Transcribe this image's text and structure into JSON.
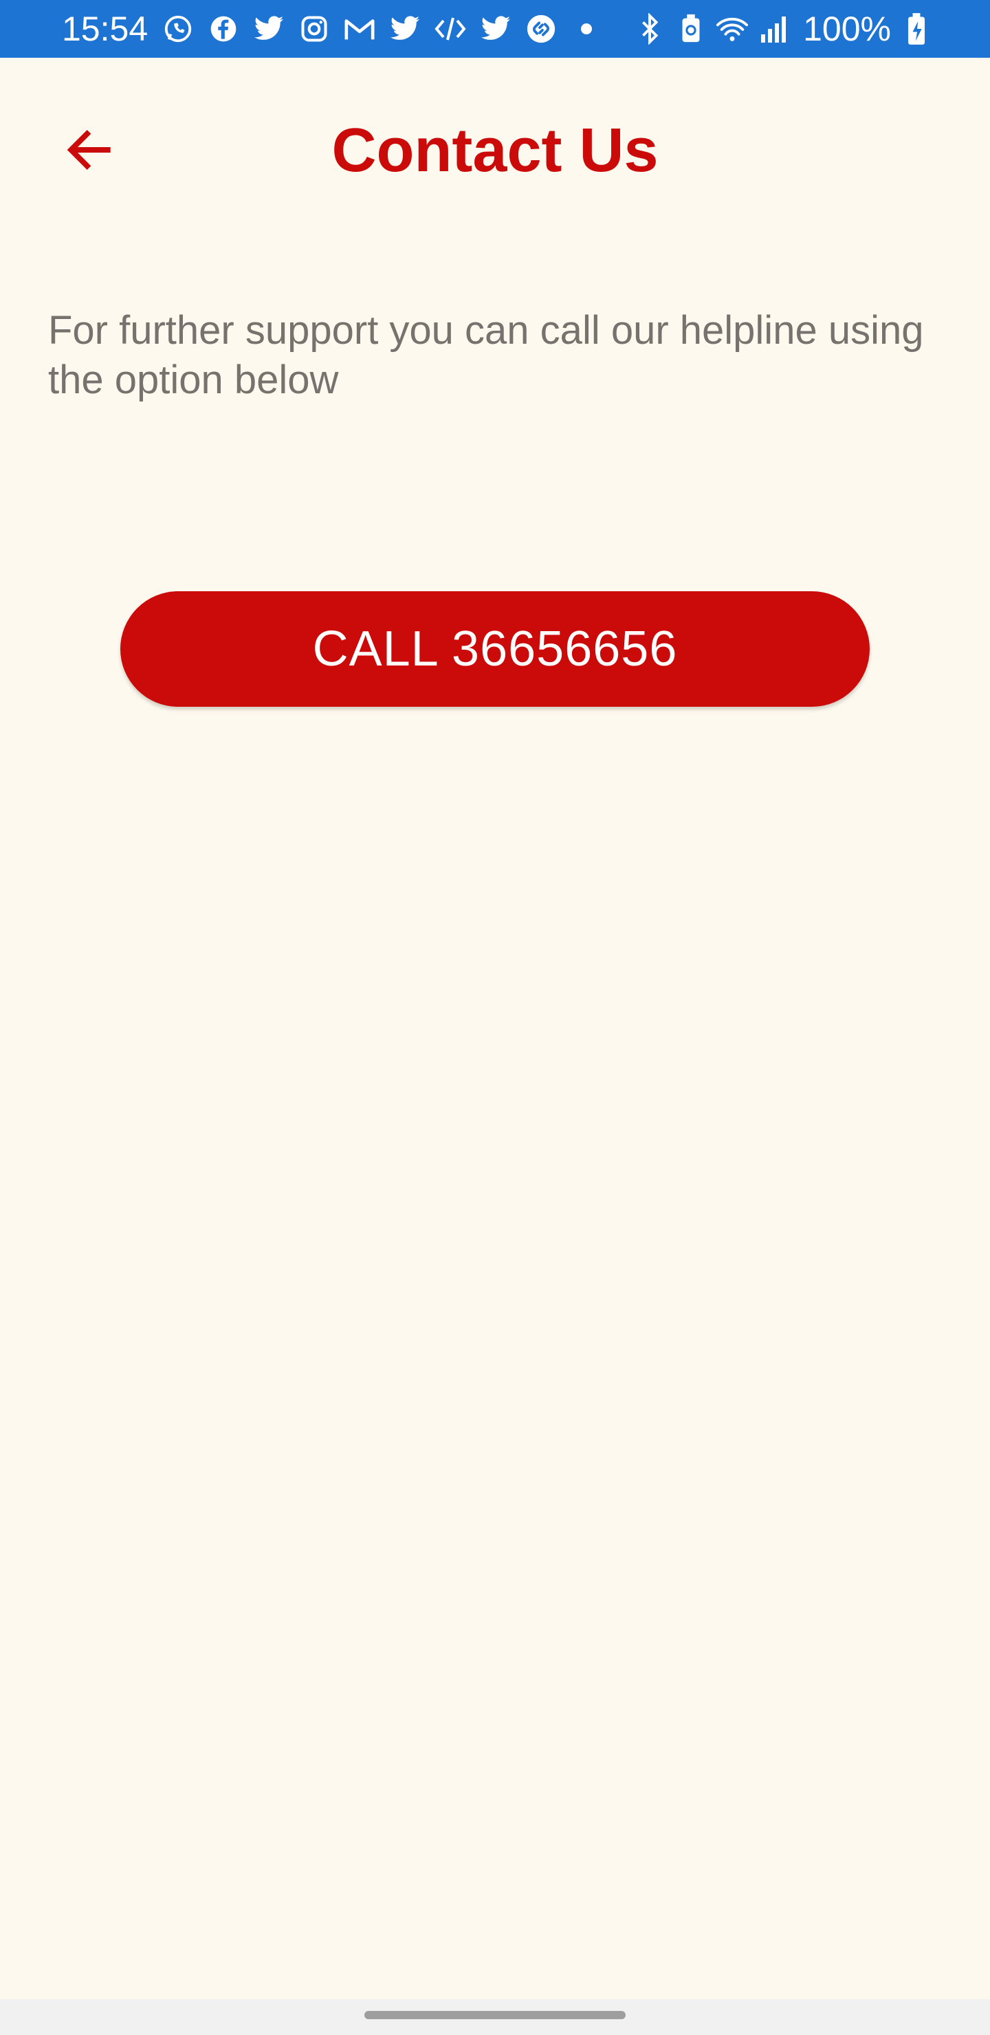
{
  "status_bar": {
    "time": "15:54",
    "notification_icons": [
      "whatsapp-icon",
      "facebook-icon",
      "twitter-icon",
      "instagram-icon",
      "gmail-icon",
      "twitter-icon",
      "code-icon",
      "twitter-icon",
      "shazam-icon",
      "dot-icon"
    ],
    "system_icons": [
      "bluetooth-icon",
      "battery-saver-icon",
      "wifi-icon",
      "signal-icon"
    ],
    "battery": "100%",
    "colors": {
      "background": "#1E74D3",
      "foreground": "#FFFFFF"
    }
  },
  "header": {
    "title": "Contact Us",
    "back_icon": "arrow-left-icon",
    "accent_color": "#CB0A0A"
  },
  "main": {
    "description": "For further support you can call our helpline using the option below",
    "call_button_label": "CALL 36656656"
  },
  "colors": {
    "page_background": "#FEF9EE",
    "text_secondary": "#76736E",
    "button_background": "#CB0A0A"
  }
}
